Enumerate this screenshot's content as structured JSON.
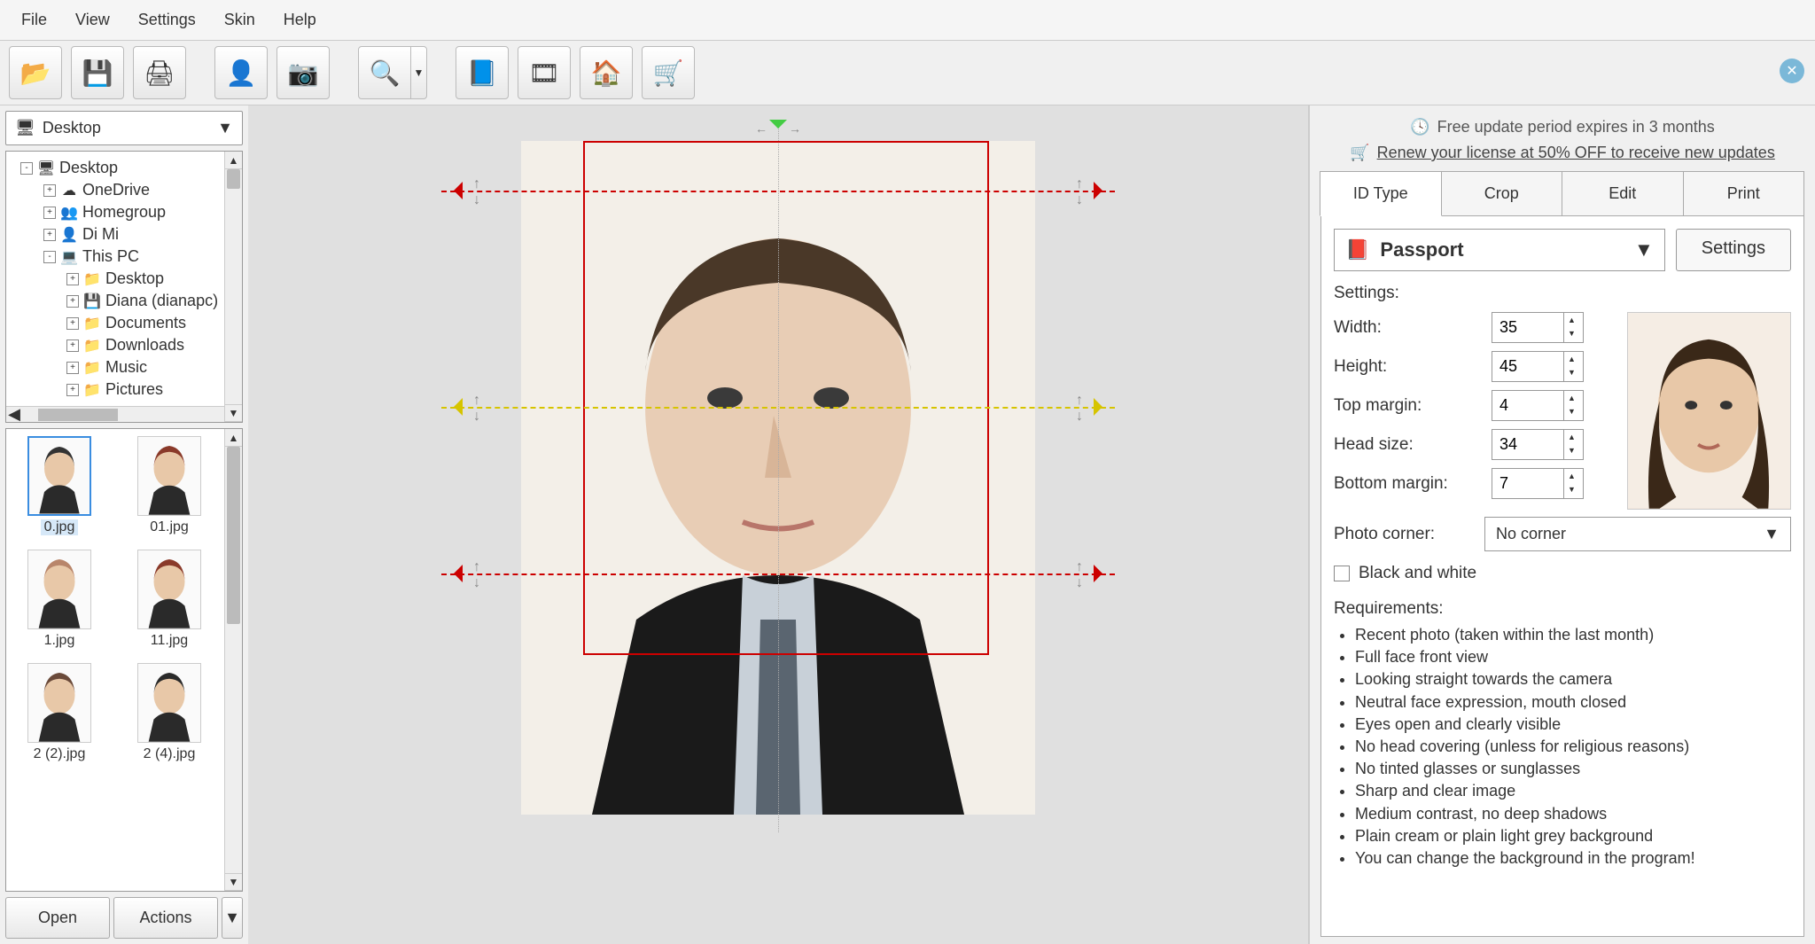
{
  "menu": [
    "File",
    "View",
    "Settings",
    "Skin",
    "Help"
  ],
  "banner": {
    "line1": "Free update period expires in 3 months",
    "line2": "Renew your license at 50% OFF to receive new updates"
  },
  "location": "Desktop",
  "tree": [
    {
      "level": 0,
      "exp": "-",
      "icon": "🖥",
      "label": "Desktop"
    },
    {
      "level": 1,
      "exp": "+",
      "icon": "☁",
      "label": "OneDrive"
    },
    {
      "level": 1,
      "exp": "+",
      "icon": "👥",
      "label": "Homegroup"
    },
    {
      "level": 1,
      "exp": "+",
      "icon": "👤",
      "label": "Di Mi"
    },
    {
      "level": 1,
      "exp": "-",
      "icon": "💻",
      "label": "This PC"
    },
    {
      "level": 2,
      "exp": "+",
      "icon": "📁",
      "label": "Desktop"
    },
    {
      "level": 2,
      "exp": "+",
      "icon": "💾",
      "label": "Diana (dianapc)"
    },
    {
      "level": 2,
      "exp": "+",
      "icon": "📁",
      "label": "Documents"
    },
    {
      "level": 2,
      "exp": "+",
      "icon": "📁",
      "label": "Downloads"
    },
    {
      "level": 2,
      "exp": "+",
      "icon": "📁",
      "label": "Music"
    },
    {
      "level": 2,
      "exp": "+",
      "icon": "📁",
      "label": "Pictures"
    }
  ],
  "thumbs": [
    "0.jpg",
    "01.jpg",
    "1.jpg",
    "11.jpg",
    "2 (2).jpg",
    "2 (4).jpg"
  ],
  "buttons": {
    "open": "Open",
    "actions": "Actions"
  },
  "tabs": {
    "id": "ID Type",
    "crop": "Crop",
    "edit": "Edit",
    "print": "Print"
  },
  "idtype": {
    "name": "Passport",
    "settings_btn": "Settings"
  },
  "settings": {
    "heading": "Settings:",
    "width_label": "Width:",
    "width": "35",
    "height_label": "Height:",
    "height": "45",
    "top_label": "Top margin:",
    "top": "4",
    "head_label": "Head size:",
    "head": "34",
    "bottom_label": "Bottom margin:",
    "bottom": "7",
    "corner_label": "Photo corner:",
    "corner": "No corner",
    "bw_label": "Black and white"
  },
  "requirements": {
    "heading": "Requirements:",
    "items": [
      "Recent photo (taken within the last month)",
      "Full face front view",
      "Looking straight towards the camera",
      "Neutral face expression, mouth closed",
      "Eyes open and clearly visible",
      "No head covering (unless for religious reasons)",
      "No tinted glasses or sunglasses",
      "Sharp and clear image",
      "Medium contrast, no deep shadows",
      "Plain cream or plain light grey background",
      "You can change the background in the program!"
    ]
  }
}
